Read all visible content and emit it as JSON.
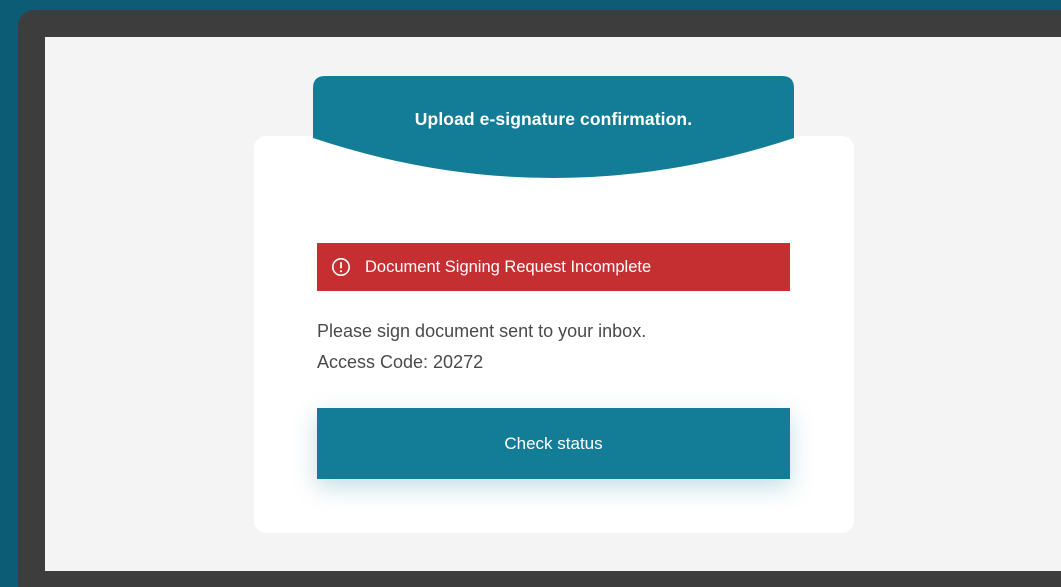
{
  "header": {
    "title": "Upload e-signature confirmation."
  },
  "alert": {
    "icon": "exclamation-circle-icon",
    "message": "Document Signing Request Incomplete"
  },
  "instructions": {
    "line1": "Please sign document sent to your inbox.",
    "line2": "Access Code: 20272"
  },
  "actions": {
    "check_status_label": "Check status"
  },
  "colors": {
    "page_background": "#0d5c75",
    "frame": "#3d3d3d",
    "viewport": "#f4f4f4",
    "accent": "#137c96",
    "alert": "#c62f31",
    "text": "#4a4a4a"
  }
}
